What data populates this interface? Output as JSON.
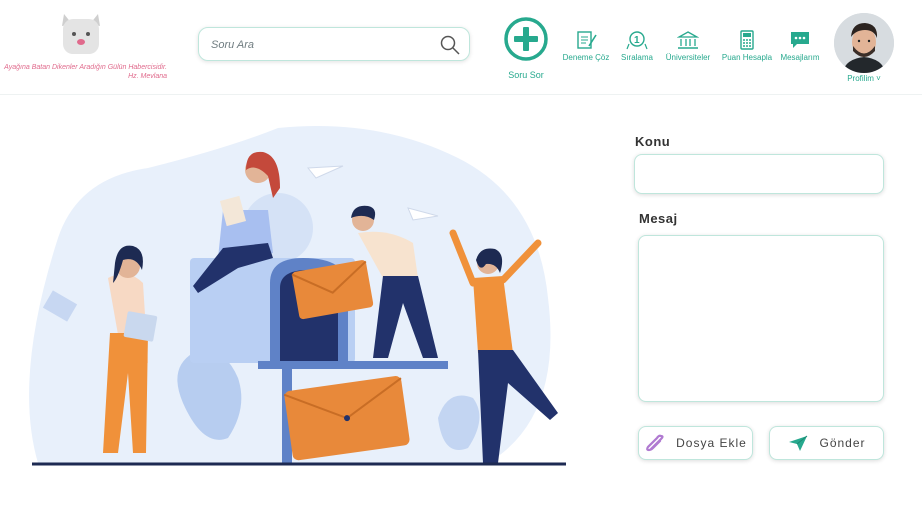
{
  "header": {
    "quote": "Ayağına Batan Dikenler Aradığın Gülün Habercisidir. Hz. Mevlana",
    "search": {
      "placeholder": "Soru Ara"
    },
    "ask_label": "Soru Sor",
    "nav": [
      {
        "label": "Deneme Çöz",
        "icon": "exam-icon"
      },
      {
        "label": "Sıralama",
        "icon": "ranking-icon"
      },
      {
        "label": "Üniversiteler",
        "icon": "university-icon"
      },
      {
        "label": "Puan Hesapla",
        "icon": "calculator-icon"
      },
      {
        "label": "Mesajlarım",
        "icon": "message-icon"
      }
    ],
    "profile_label": "Profilim ˅"
  },
  "form": {
    "subject_label": "Konu",
    "subject_value": "",
    "message_label": "Mesaj",
    "message_value": "",
    "attach_label": "Dosya Ekle",
    "send_label": "Gönder"
  },
  "colors": {
    "accent": "#27a98e",
    "pink": "#e06a8c",
    "orange": "#f0913a",
    "navy": "#22326b"
  }
}
